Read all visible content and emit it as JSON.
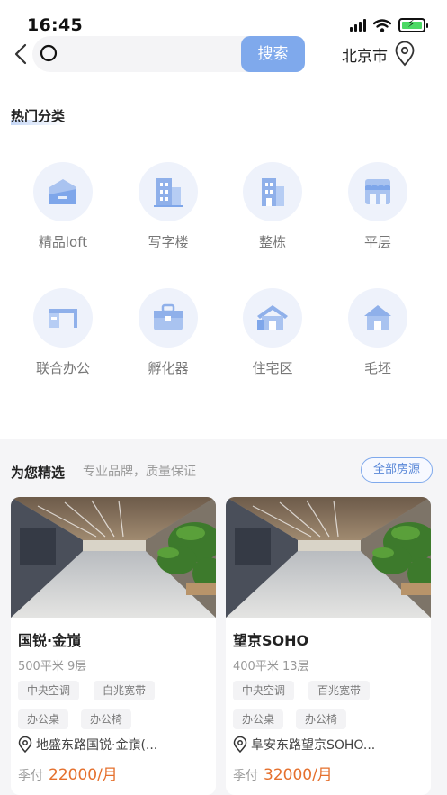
{
  "status": {
    "time": "16:45"
  },
  "header": {
    "search_placeholder": "",
    "search_button": "搜索",
    "city": "北京市"
  },
  "hot": {
    "title": "热门分类",
    "categories": [
      {
        "label": "精品loft",
        "icon": "loft-icon"
      },
      {
        "label": "写字楼",
        "icon": "office-building-icon"
      },
      {
        "label": "整栋",
        "icon": "whole-building-icon"
      },
      {
        "label": "平层",
        "icon": "flat-floor-icon"
      },
      {
        "label": "联合办公",
        "icon": "cowork-desk-icon"
      },
      {
        "label": "孵化器",
        "icon": "incubator-briefcase-icon"
      },
      {
        "label": "住宅区",
        "icon": "residential-icon"
      },
      {
        "label": "毛坯",
        "icon": "raw-house-icon"
      }
    ]
  },
  "recommend": {
    "title": "为您精选",
    "subtitle": "专业品牌，质量保证",
    "all_button": "全部房源",
    "cards": [
      {
        "name": "国锐·金嵿",
        "spec": "500平米 9层",
        "tags": [
          "中央空调",
          "白兆宽带",
          "办公桌",
          "办公椅"
        ],
        "address": "地盛东路国锐·金嵿(...",
        "price_label": "季付",
        "price": "22000/月"
      },
      {
        "name": "望京SOHO",
        "spec": "400平米 13层",
        "tags": [
          "中央空调",
          "百兆宽带",
          "办公桌",
          "办公椅"
        ],
        "address": "阜安东路望京SOHO...",
        "price_label": "季付",
        "price": "32000/月"
      }
    ]
  },
  "colors": {
    "accent": "#7fa9ec",
    "price": "#e5702d",
    "icon": "#8fb0ea"
  }
}
